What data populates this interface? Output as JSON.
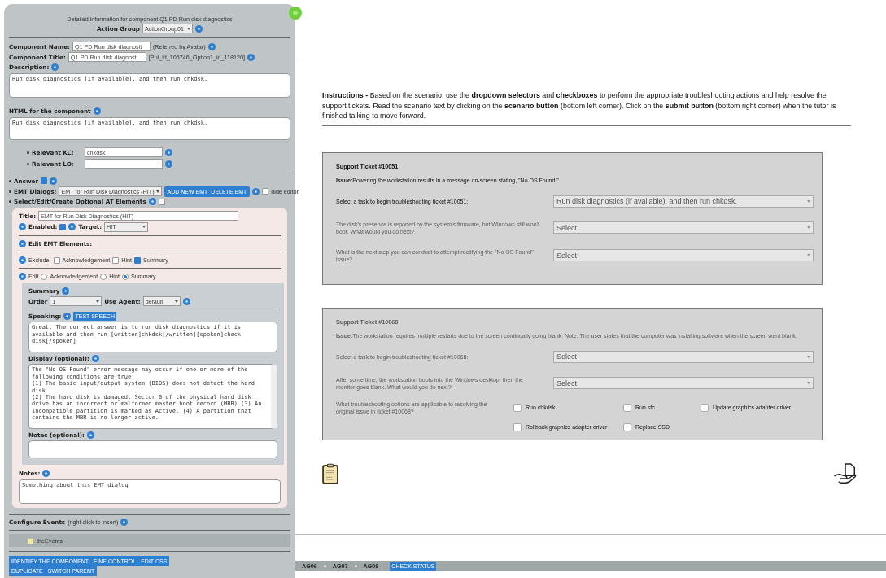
{
  "editor": {
    "heading": "Detailed information for component Q1 PD Run disk diagnostics",
    "action_group": {
      "label": "Action Group",
      "value": "ActionGroup01"
    },
    "component_name": {
      "label": "Component Name:",
      "value": "Q1 PD Run disk diagnosti",
      "note": "(Referred by Avatar)"
    },
    "component_title": {
      "label": "Component Title:",
      "value": "Q1 PD Run disk diagnosti",
      "note": "[Pul_id_105746_Option1_id_118120]"
    },
    "description": {
      "label": "Description:",
      "value": "Run disk diagnostics [if available], and then run chkdsk."
    },
    "html": {
      "label": "HTML for the component",
      "value": "Run disk diagnostics [if available], and then run chkdsk."
    },
    "relevant": [
      {
        "label": "Relevant KC:",
        "value": "chkdsk"
      },
      {
        "label": "Relevant LO:"
      }
    ],
    "answer": {
      "label": "Answer",
      "checked": true
    },
    "emt_dialogs": {
      "label": "EMT Dialogs:",
      "value": "EMT for Run Disk Diagnostics (HIT)",
      "buttons": [
        "ADD NEW EMT",
        "DELETE EMT"
      ],
      "hide_editor": {
        "label": "hide editor",
        "checked": false
      }
    },
    "optional_at": {
      "label": "Select/Edit/Create Optional AT Elements",
      "checked": false
    },
    "emt": {
      "title": {
        "label": "Title:",
        "value": "EMT for Run Disk Diagnostics (HIT)"
      },
      "enabled": {
        "label": "Enabled:",
        "checked": true
      },
      "target": {
        "label": "Target:",
        "value": "HIT"
      },
      "edit_elements_label": "Edit EMT Elements:",
      "exclude": {
        "label": "Exclude:",
        "options": [
          {
            "label": "Acknowledgement",
            "checked": false
          },
          {
            "label": "Hint",
            "checked": false
          },
          {
            "label": "Summary",
            "checked": true
          }
        ]
      },
      "edit": {
        "label": "Edit",
        "options": [
          {
            "label": "Acknowledgement",
            "selected": false
          },
          {
            "label": "Hint",
            "selected": false
          },
          {
            "label": "Summary",
            "selected": true
          }
        ]
      },
      "summary": {
        "heading": "Summary",
        "order": {
          "label": "Order",
          "value": "1"
        },
        "agent": {
          "label": "Use Agent:",
          "value": "default"
        },
        "speaking": {
          "label": "Speaking:",
          "button": "TEST SPEECH",
          "value": "Great. The correct answer is to run disk diagnostics if it is available and then run [written]chkdsk[/written][spoken]check disk[/spoken]"
        },
        "display": {
          "label": "Display (optional):",
          "value": "The \"No OS Found\" error message may occur if one or more of the following conditions are true:\n(1) The basic input/output system (BIOS) does not detect the hard disk.\n(2) The hard disk is damaged. Sector 0 of the physical hard disk drive has an incorrect or malformed master boot record (MBR).(3) An incompatible partition is marked as Active. (4) A partition that contains the MBR is no longer active."
        },
        "notes": {
          "label": "Notes (optional):"
        }
      },
      "notes": {
        "label": "Notes:",
        "value": "Something about this EMT dialog"
      }
    },
    "events": {
      "label": "Configure Events",
      "hint": "(right click to insert)",
      "tree_item": "theEvents"
    },
    "buttons": [
      "IDENTIFY THE COMPONENT",
      "FINE CONTROL",
      "EDIT CSS",
      "DUPLICATE",
      "SWITCH PARENT"
    ]
  },
  "instructions": "**Instructions -** Based on the scenario, use the **dropdown selectors** and **checkboxes** to perform the appropriate troubleshooting actions and help resolve the support tickets. Read the scenario text by clicking on the **scenario button** (bottom left corner). Click on the **submit button** (bottom right corner) when the tutor is finished talking to move forward.",
  "tickets": [
    {
      "title": "Support Ticket #10051",
      "disabled": false,
      "issue_label": "Issue:",
      "issue": "Powering the workstation results in a message on-screen stating, \"No OS Found.\"",
      "questions": [
        {
          "text": "Select a task to begin troubleshooting ticket #10051:",
          "value": "Run disk diagnostics (if available), and then run chkdsk.",
          "disabled": false
        },
        {
          "text": "The disk's presence is reported by the system's firmware, but Windows still won't boot. What would you do next?",
          "value": "Select",
          "disabled": true
        },
        {
          "text": "What is the next step you can conduct to attempt rectifying the \"No OS Found\" issue?",
          "value": "Select",
          "disabled": true
        }
      ]
    },
    {
      "title": "Support Ticket #10068",
      "disabled": true,
      "issue_label": "Issue:",
      "issue": "The workstation requires multiple restarts due to the screen continually going blank. Note: The user states that the computer was installing software when the screen went blank.",
      "questions": [
        {
          "text": "Select a task to begin troubleshooting ticket #10068:",
          "value": "Select",
          "disabled": true
        },
        {
          "text": "After some time, the workstation boots into the Windows desktop, then the monitor goes blank. What would you do next?",
          "value": "Select",
          "disabled": true
        }
      ],
      "checks": {
        "text": "What troubleshooting options are applicable to resolving the original issue in ticket #10068?",
        "disabled": true,
        "options": [
          {
            "label": "Run chkdsk",
            "checked": false
          },
          {
            "label": "Run sfc",
            "checked": false
          },
          {
            "label": "Update graphics adapter driver",
            "checked": false
          },
          {
            "label": "Rollback graphics adapter driver",
            "checked": false
          },
          {
            "label": "Replace SSD",
            "checked": false
          }
        ]
      }
    }
  ],
  "bottom_bar": {
    "tabs": [
      "AG06",
      "AG07",
      "AG08"
    ],
    "button": "CHECK STATUS"
  }
}
